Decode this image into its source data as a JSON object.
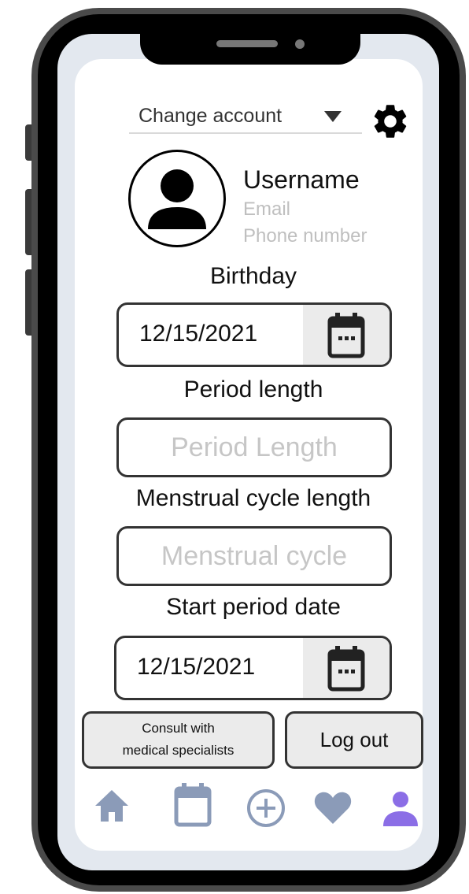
{
  "account": {
    "select_label": "Change account",
    "settings_icon": "gear-icon"
  },
  "profile": {
    "username": "Username",
    "email": "Email",
    "phone": "Phone number",
    "avatar_icon": "user-avatar-icon"
  },
  "birthday": {
    "label": "Birthday",
    "value": "12/15/2021"
  },
  "period_length": {
    "label": "Period length",
    "placeholder": "Period Length"
  },
  "cycle_length": {
    "label": "Menstrual cycle length",
    "placeholder": "Menstrual cycle"
  },
  "start_period": {
    "label": "Start period date",
    "value": "12/15/2021"
  },
  "actions": {
    "consult_line1": "Consult with",
    "consult_line2": "medical specialists",
    "logout": "Log out"
  },
  "bottom_nav": {
    "items": [
      "home-icon",
      "calendar-icon",
      "add-circle-icon",
      "heart-icon",
      "profile-icon"
    ],
    "active": "profile-icon",
    "inactive_color": "#8b9bb8",
    "active_color": "#8b6ee6"
  }
}
